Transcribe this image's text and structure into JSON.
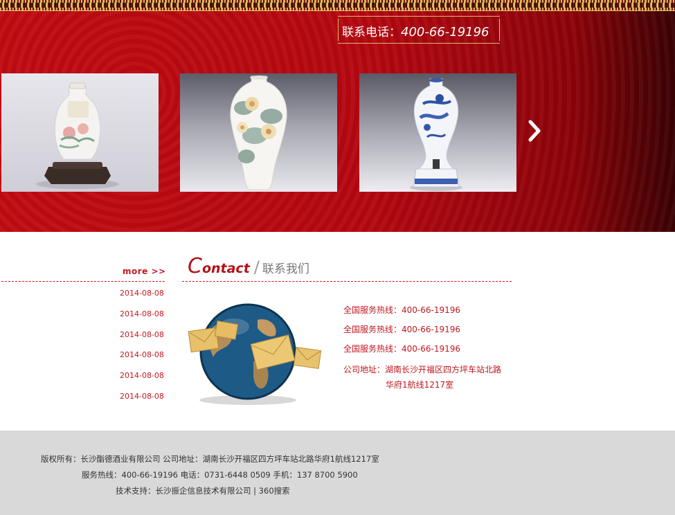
{
  "header": {
    "phone_label": "联系电话：",
    "phone_number": "400-66-19196"
  },
  "carousel": {
    "items": [
      {
        "icon": "white-porcelain-vase-on-stand"
      },
      {
        "icon": "flower-painted-porcelain-vase"
      },
      {
        "icon": "blue-white-porcelain-wine-jar"
      }
    ],
    "next_icon": "chevron-right-icon"
  },
  "news": {
    "more_label": "more >>",
    "dates": [
      "2014-08-08",
      "2014-08-08",
      "2014-08-08",
      "2014-08-08",
      "2014-08-08",
      "2014-08-08"
    ]
  },
  "contact": {
    "title_big": "C",
    "title_rest": "ontact",
    "title_cn": "联系我们",
    "hotline_1": "全国服务热线：400-66-19196",
    "hotline_2": "全国服务热线：400-66-19196",
    "hotline_3": "全国服务热线：400-66-19196",
    "address_1": "公司地址：湖南长沙开福区四方坪车站北路",
    "address_2": "华府1航线1217室",
    "image_icon": "globe-with-envelopes"
  },
  "footer": {
    "line1": "版权所有：长沙酯德酒业有限公司  公司地址：湖南长沙开福区四方坪车站北路华府1航线1217室",
    "line2": "服务热线：400-66-19196    电话：0731-6448 0509  手机：137 8700 5900",
    "line3": "技术支持：长沙振企信息技术有限公司  |  360搜索"
  },
  "colors": {
    "banner_red": "#c10b12",
    "accent_red": "#c8161e",
    "footer_gray": "#d9d9d9"
  }
}
